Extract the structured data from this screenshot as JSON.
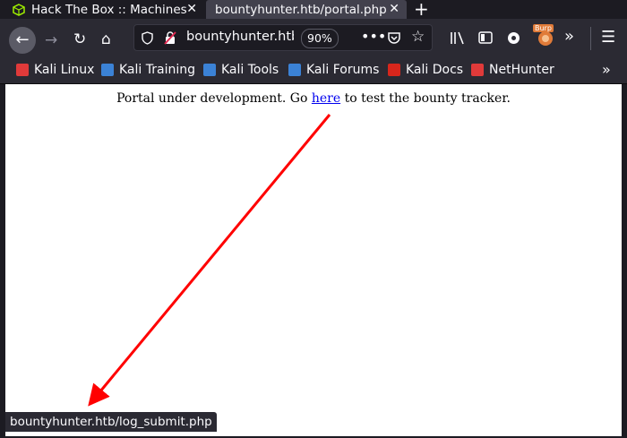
{
  "tabs": [
    {
      "title": "Hack The Box :: Machines",
      "active": false,
      "icon": "hackthebox-cube-icon"
    },
    {
      "title": "bountyhunter.htb/portal.php",
      "active": true,
      "icon": "none"
    }
  ],
  "navbar": {
    "url": "bountyhunter.htb/portal.php",
    "zoom": "90%",
    "burp_label": "Burp"
  },
  "bookmarks": [
    {
      "label": "Kali Linux",
      "color": "#e03a3a"
    },
    {
      "label": "Kali Training",
      "color": "#3b82d6"
    },
    {
      "label": "Kali Tools",
      "color": "#3b82d6"
    },
    {
      "label": "Kali Forums",
      "color": "#3b82d6"
    },
    {
      "label": "Kali Docs",
      "color": "#d7261c"
    },
    {
      "label": "NetHunter",
      "color": "#e03a3a"
    }
  ],
  "page": {
    "text_before": "Portal under development. Go ",
    "link_text": "here",
    "text_after": " to test the bounty tracker."
  },
  "status_bar": {
    "text": "bountyhunter.htb/log_submit.php"
  },
  "colors": {
    "annotation_arrow": "#ff0000",
    "link": "#0000ee"
  }
}
